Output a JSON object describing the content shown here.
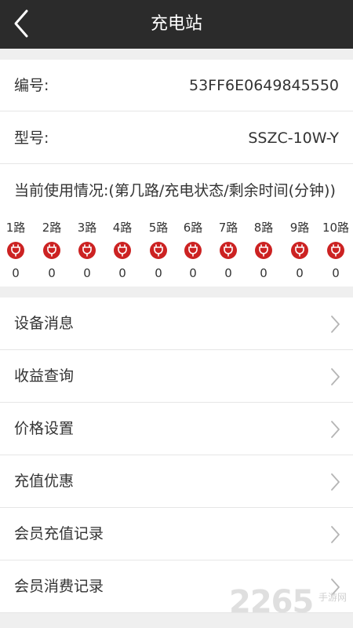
{
  "header": {
    "title": "充电站",
    "back_icon": "chevron-left-icon"
  },
  "device": {
    "serial_label": "编号:",
    "serial_value": "53FF6E0649845550",
    "model_label": "型号:",
    "model_value": "SSZC-10W-Y"
  },
  "usage": {
    "title": "当前使用情况:(第几路/充电状态/剩余时间(分钟))",
    "ports": [
      {
        "name": "1路",
        "time": "0"
      },
      {
        "name": "2路",
        "time": "0"
      },
      {
        "name": "3路",
        "time": "0"
      },
      {
        "name": "4路",
        "time": "0"
      },
      {
        "name": "5路",
        "time": "0"
      },
      {
        "name": "6路",
        "time": "0"
      },
      {
        "name": "7路",
        "time": "0"
      },
      {
        "name": "8路",
        "time": "0"
      },
      {
        "name": "9路",
        "time": "0"
      },
      {
        "name": "10路",
        "time": "0"
      }
    ],
    "status_icon": "power-plug-icon",
    "status_color": "#cc2222"
  },
  "menu": [
    {
      "label": "设备消息"
    },
    {
      "label": "收益查询"
    },
    {
      "label": "价格设置"
    },
    {
      "label": "充值优惠"
    },
    {
      "label": "会员充值记录"
    },
    {
      "label": "会员消费记录"
    }
  ],
  "watermark": {
    "digits": "2265",
    "text": "手游网"
  },
  "colors": {
    "header_bg": "#2b2b2b",
    "accent_red": "#cc2222",
    "page_bg": "#efefef"
  }
}
